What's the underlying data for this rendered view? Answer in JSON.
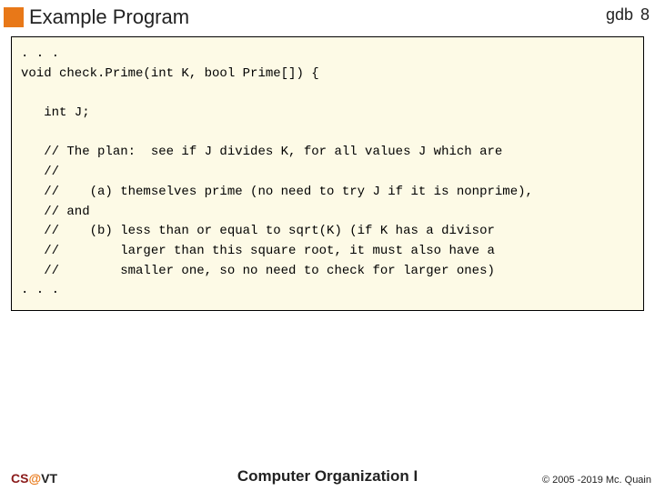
{
  "header": {
    "title": "Example Program",
    "label": "gdb",
    "pageNumber": "8"
  },
  "code": {
    "l01": ". . .",
    "l02": "void check.Prime(int K, bool Prime[]) {",
    "l03": "",
    "l04": "   int J;",
    "l05": "",
    "l06": "   // The plan:  see if J divides K, for all values J which are",
    "l07": "   //",
    "l08": "   //    (a) themselves prime (no need to try J if it is nonprime),",
    "l09": "   // and",
    "l10": "   //    (b) less than or equal to sqrt(K) (if K has a divisor",
    "l11": "   //        larger than this square root, it must also have a",
    "l12": "   //        smaller one, so no need to check for larger ones)",
    "l13": ". . ."
  },
  "footer": {
    "left": {
      "cs": "CS",
      "at": "@",
      "vt": "VT"
    },
    "center": "Computer Organization I",
    "right": "© 2005 -2019 Mc. Quain"
  }
}
